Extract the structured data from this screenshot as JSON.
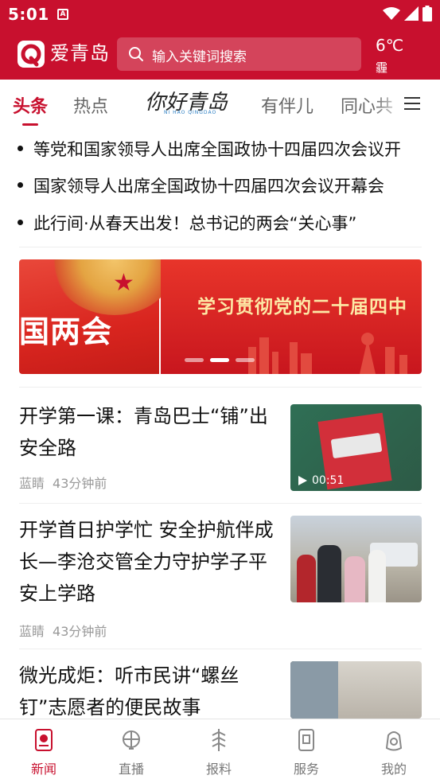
{
  "status_bar": {
    "time": "5:01",
    "notification_glyph": "A"
  },
  "app_bar": {
    "app_name": "爱青岛",
    "search_placeholder": "输入关键词搜索",
    "weather": {
      "temperature": "6℃",
      "condition": "霾"
    }
  },
  "tabs": {
    "items": [
      "头条",
      "热点",
      "你好青岛",
      "有伴儿",
      "同心共"
    ],
    "special_tab_subtitle": "NI HAO QINGDAO",
    "active_index": 0
  },
  "headlines": [
    "等党和国家领导人出席全国政协十四届四次会议开",
    "国家领导人出席全国政协十四届四次会议开幕会",
    "此行间·从春天出发！总书记的两会“关心事”"
  ],
  "banner": {
    "left_title": "国两会",
    "right_slogan": "学习贯彻党的二十届四中",
    "dot_count": 3,
    "active_dot": 1
  },
  "news": [
    {
      "title": "开学第一课：青岛巴士“铺”出安全路",
      "source": "蓝睛",
      "time": "43分钟前",
      "video_duration": "00:51"
    },
    {
      "title": "开学首日护学忙 安全护航伴成长—李沧交管全力守护学子平安上学路",
      "source": "蓝睛",
      "time": "43分钟前"
    },
    {
      "title": "微光成炬：听市民讲“螺丝钉”志愿者的便民故事"
    }
  ],
  "bottom_nav": {
    "items": [
      "新闻",
      "直播",
      "报料",
      "服务",
      "我的"
    ],
    "active_index": 0
  },
  "colors": {
    "brand_red": "#c8102e",
    "meta_gray": "#999999"
  }
}
